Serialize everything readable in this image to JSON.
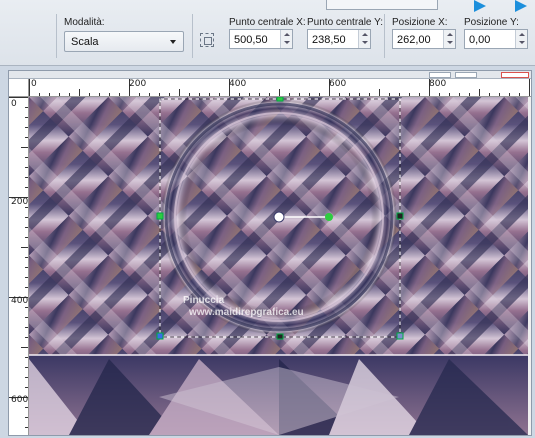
{
  "toolbar": {
    "mode_label": "Modalità:",
    "mode_value": "Scala",
    "center_x_label": "Punto centrale X:",
    "center_x_value": "500,50",
    "center_y_label": "Punto centrale Y:",
    "center_y_value": "238,50",
    "pos_x_label": "Posizione X:",
    "pos_x_value": "262,00",
    "pos_y_label": "Posizione Y:",
    "pos_y_value": "0,00"
  },
  "ruler": {
    "h_ticks": [
      "0",
      "200",
      "400",
      "600",
      "800"
    ],
    "v_ticks": [
      "0",
      "200",
      "400",
      "600"
    ]
  },
  "watermark": {
    "line1": "Pinuccia",
    "line2": "www.maidirepgrafica.eu"
  },
  "colors": {
    "accent": "#1c8fdc",
    "canvas_dark": "#26294f",
    "canvas_mauve": "#9c7592",
    "canvas_tan": "#b08a70",
    "handle": "#2ecc40"
  }
}
